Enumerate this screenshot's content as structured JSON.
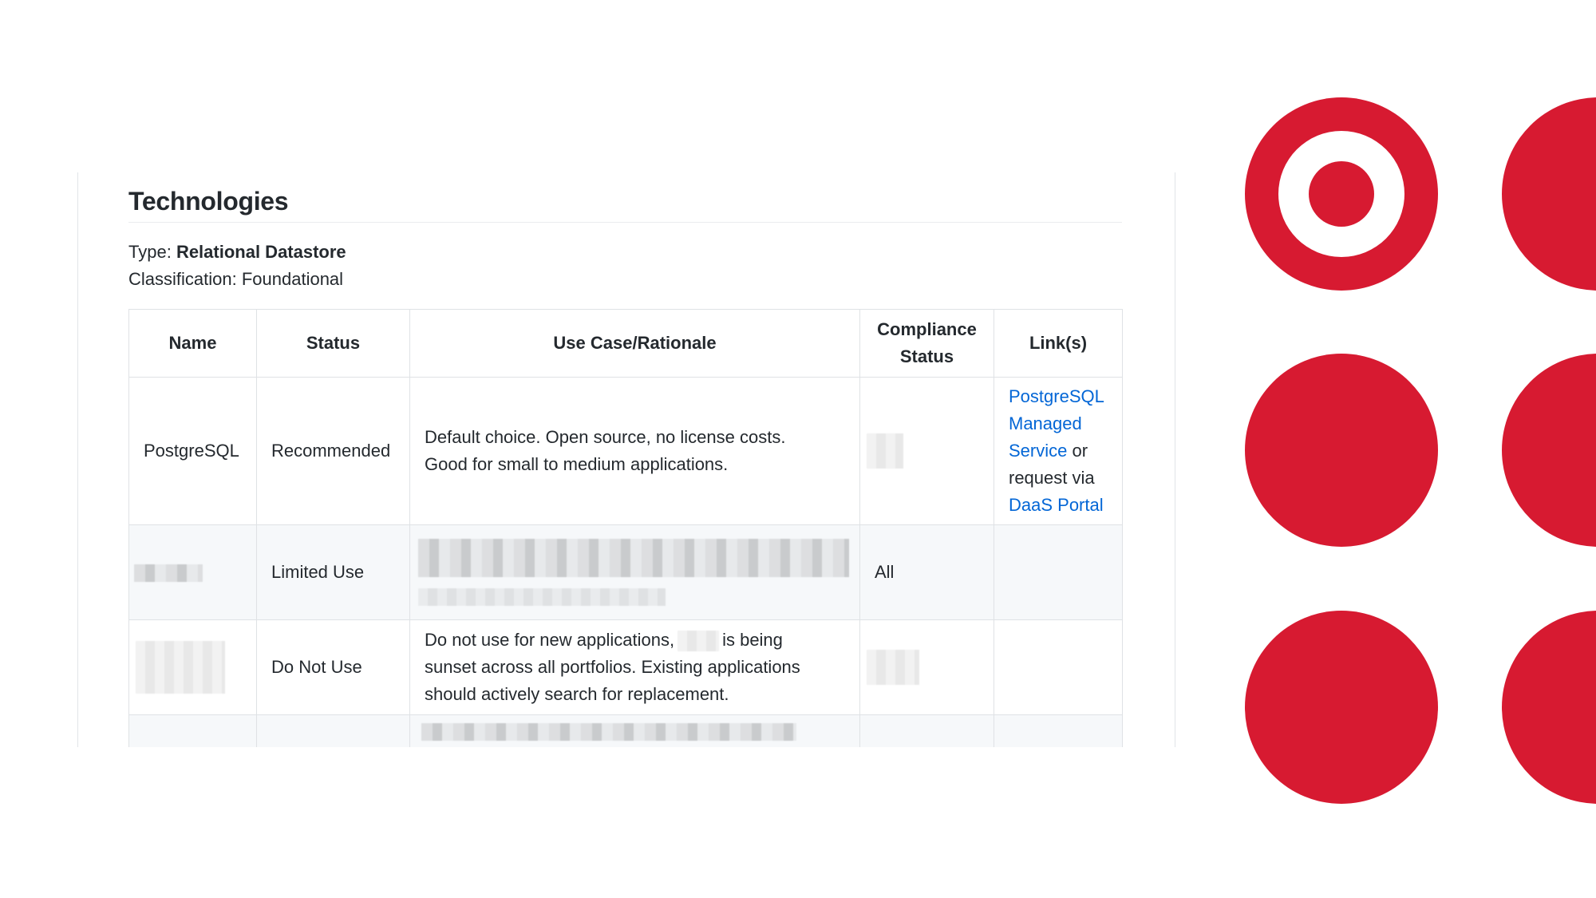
{
  "section": {
    "title": "Technologies",
    "type_label": "Type:",
    "type_value": "Relational Datastore",
    "classification_label": "Classification:",
    "classification_value": "Foundational"
  },
  "table": {
    "headers": {
      "name": "Name",
      "status": "Status",
      "use_case": "Use Case/Rationale",
      "compliance_line1": "Compliance",
      "compliance_line2": "Status",
      "links": "Link(s)"
    },
    "rows": [
      {
        "name": "PostgreSQL",
        "status": "Recommended",
        "use_case_line1": "Default choice. Open source, no license costs.",
        "use_case_line2": "Good for small to medium applications.",
        "compliance": "",
        "links": {
          "link1_line1": "PostgreSQL",
          "link1_line2": "Managed",
          "link1_line3": "Service",
          "connector1": " or",
          "connector2": "request via",
          "link2": "DaaS Portal"
        }
      },
      {
        "name": "",
        "status": "Limited Use",
        "use_case": "",
        "compliance": "All",
        "links": ""
      },
      {
        "name": "",
        "status": "Do Not Use",
        "use_case_part1": "Do not use for new applications,",
        "use_case_part2": "is being",
        "use_case_line2": "sunset across all portfolios. Existing applications",
        "use_case_line3": "should actively search for replacement.",
        "compliance": "",
        "links": ""
      }
    ]
  },
  "branding": {
    "logo": "target-bullseye-logo",
    "accent_color": "#d71a31",
    "link_color": "#0366d6"
  }
}
